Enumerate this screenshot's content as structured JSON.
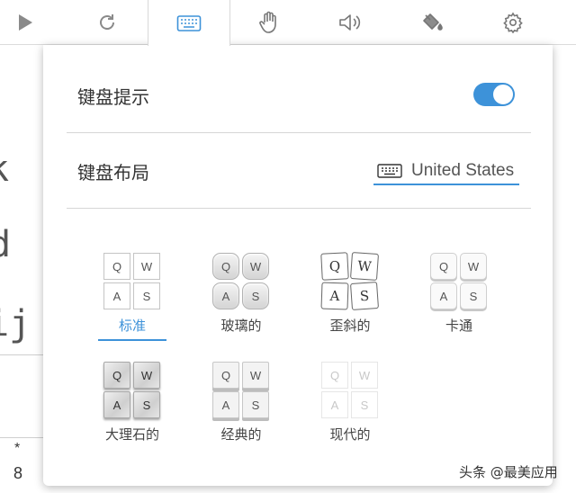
{
  "toolbar": {
    "items": [
      {
        "icon": "play-icon",
        "active": false
      },
      {
        "icon": "redo-icon",
        "active": false
      },
      {
        "icon": "keyboard-icon",
        "active": true
      },
      {
        "icon": "hand-icon",
        "active": false
      },
      {
        "icon": "speaker-icon",
        "active": false
      },
      {
        "icon": "paint-bucket-icon",
        "active": false
      },
      {
        "icon": "gear-icon",
        "active": false
      }
    ],
    "accent_color": "#3d92d9"
  },
  "background": {
    "glyphs": [
      "k",
      "d",
      "ij"
    ],
    "keypad_symbol": "*",
    "keypad_digit": "8"
  },
  "panel": {
    "keyboard_hints": {
      "label": "键盘提示",
      "enabled": true
    },
    "keyboard_layout": {
      "label": "键盘布局",
      "value": "United States"
    },
    "styles": [
      {
        "id": "standard",
        "label": "标准",
        "selected": true,
        "keys": [
          "Q",
          "W",
          "A",
          "S"
        ]
      },
      {
        "id": "glass",
        "label": "玻璃的",
        "selected": false,
        "keys": [
          "Q",
          "W",
          "A",
          "S"
        ]
      },
      {
        "id": "skewed",
        "label": "歪斜的",
        "selected": false,
        "keys": [
          "Q",
          "W",
          "A",
          "S"
        ]
      },
      {
        "id": "cartoon",
        "label": "卡通",
        "selected": false,
        "keys": [
          "Q",
          "W",
          "A",
          "S"
        ]
      },
      {
        "id": "marble",
        "label": "大理石的",
        "selected": false,
        "keys": [
          "Q",
          "W",
          "A",
          "S"
        ]
      },
      {
        "id": "classic",
        "label": "经典的",
        "selected": false,
        "keys": [
          "Q",
          "W",
          "A",
          "S"
        ]
      },
      {
        "id": "modern",
        "label": "现代的",
        "selected": false,
        "keys": [
          "Q",
          "W",
          "A",
          "S"
        ]
      }
    ]
  },
  "watermark": "头条 @最美应用"
}
